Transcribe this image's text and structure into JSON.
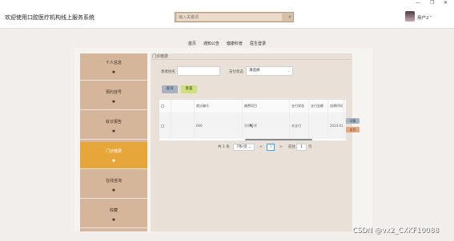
{
  "window": {
    "min": "—",
    "restore": "❐",
    "close": "✕"
  },
  "header": {
    "site_title": "欢迎使用口腔医疗机构线上服务系统",
    "search_placeholder": "输入关键词",
    "user_name": "用户2"
  },
  "nav": [
    "首页",
    "通知公告",
    "健康科普",
    "医生登录"
  ],
  "sidebar": [
    {
      "label": "个人信息",
      "icon": "gear-icon",
      "active": false
    },
    {
      "label": "预约挂号",
      "icon": "gear-icon",
      "active": false
    },
    {
      "label": "就诊报告",
      "icon": "gear-icon",
      "active": false
    },
    {
      "label": "门诊缴费",
      "icon": "gear-icon",
      "active": true
    },
    {
      "label": "在线咨询",
      "icon": "gear-icon",
      "active": false
    },
    {
      "label": "收藏",
      "icon": "gear-icon",
      "active": false
    }
  ],
  "main": {
    "breadcrumb": "门诊缴费",
    "filters": {
      "patient_label": "患者姓名",
      "patient_value": "",
      "status_label": "支付状态",
      "status_value": "请选择"
    },
    "search_button": "查询",
    "reset_button": "重置",
    "table": {
      "columns": [
        "",
        "",
        "就诊编号",
        "缴费项目",
        "支付状态",
        "支付金额",
        "创建时间",
        "操作"
      ],
      "rows": [
        {
          "index": "",
          "visit_no": "666",
          "item": "牙科手术",
          "status": "未支付",
          "amount": "",
          "created": "2024-01"
        }
      ],
      "actions": {
        "detail": "详情",
        "pay": "支付"
      }
    },
    "pagination": {
      "total": "共 1 条",
      "page_size": "7条/页",
      "prev": "<",
      "current": "1",
      "next": ">",
      "goto_label": "前往",
      "goto_value": "1",
      "goto_suffix": "页"
    }
  },
  "watermark": "CSDN @vx2_CXKF10088",
  "colors": {
    "accent": "#e6a63a",
    "sidebar": "#d5b69a",
    "panel": "#e9e1d7"
  }
}
